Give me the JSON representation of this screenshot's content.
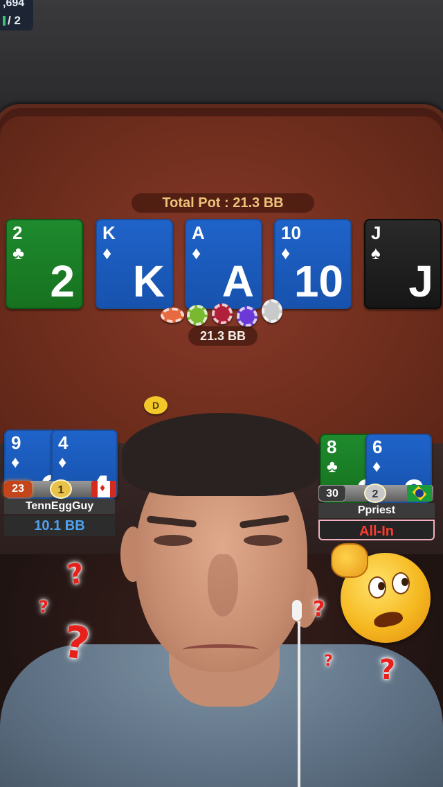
{
  "hud": {
    "line1": ",694",
    "line2": "/ 2"
  },
  "pot": {
    "label": "Total Pot : 21.3 BB",
    "amount": "21.3 BB"
  },
  "board": [
    {
      "rank": "2",
      "suit": "♣",
      "color": "green"
    },
    {
      "rank": "K",
      "suit": "♦",
      "color": "blue"
    },
    {
      "rank": "A",
      "suit": "♦",
      "color": "blue"
    },
    {
      "rank": "10",
      "suit": "♦",
      "color": "blue"
    },
    {
      "rank": "J",
      "suit": "♠",
      "color": "black"
    }
  ],
  "dealer_button": "D",
  "player_left": {
    "name": "TennEggGuy",
    "stack": "10.1 BB",
    "level": "23",
    "rank": "1",
    "flag": "canada-flag",
    "cards": [
      {
        "rank": "9",
        "suit": "♦",
        "color": "blue"
      },
      {
        "rank": "4",
        "suit": "♦",
        "color": "blue"
      }
    ]
  },
  "player_right": {
    "name": "Ppriest",
    "status": "All-In",
    "level": "30",
    "rank": "2",
    "flag": "brazil-flag",
    "cards": [
      {
        "rank": "8",
        "suit": "♣",
        "color": "green"
      },
      {
        "rank": "6",
        "suit": "♦",
        "color": "blue"
      }
    ]
  },
  "overlay": {
    "question_marks": [
      "?",
      "?",
      "?",
      "?",
      "?",
      "?",
      "?"
    ]
  },
  "colors": {
    "felt": "#74301f",
    "card_blue": "#1f63c9",
    "card_green": "#1e8a2e",
    "card_black": "#1a1a1a",
    "pot_text": "#f1c27a",
    "stack_text": "#4ea3f0",
    "allin_text": "#ff3b30"
  }
}
